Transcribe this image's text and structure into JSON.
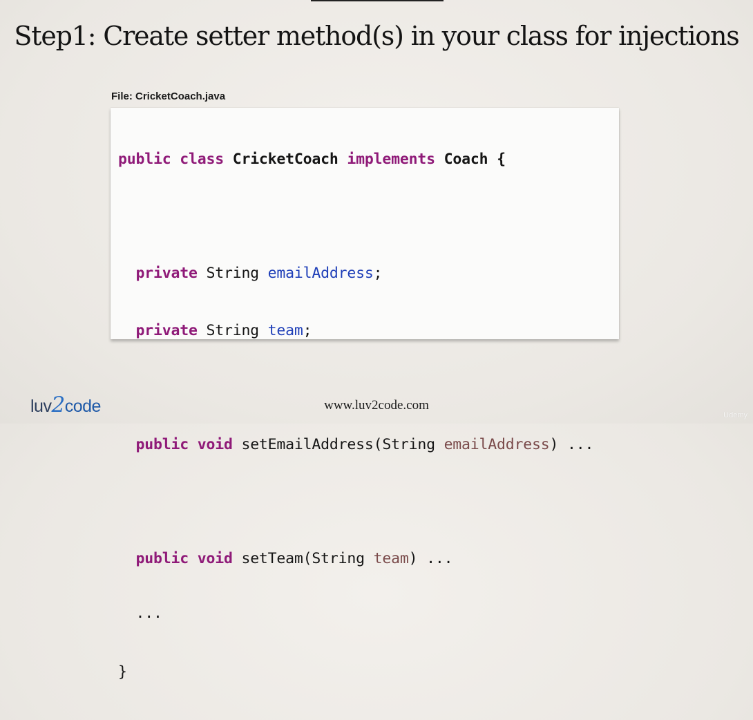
{
  "slide": {
    "title": "Step1: Create setter method(s) in your class for injections",
    "file_label": "File: CricketCoach.java"
  },
  "code": {
    "line1": {
      "kw1": "public",
      "kw2": "class",
      "cls1": "CricketCoach",
      "kw3": "implements",
      "cls2": "Coach",
      "brace": " {"
    },
    "line2": {
      "kw": "private",
      "type": " String ",
      "field": "emailAddress",
      "end": ";"
    },
    "line3": {
      "kw": "private",
      "type": " String ",
      "field": "team",
      "end": ";"
    },
    "line4": {
      "kw1": "public",
      "kw2": "void",
      "method": " setEmailAddress(String ",
      "param": "emailAddress",
      "end": ") ..."
    },
    "line5": {
      "kw1": "public",
      "kw2": "void",
      "method": " setTeam(String ",
      "param": "team",
      "end": ") ..."
    },
    "line6": {
      "text": "  ..."
    },
    "line7": {
      "text": "}"
    }
  },
  "footer": {
    "logo_part1": "luv",
    "logo_part2": "2",
    "logo_part3": "code",
    "url": "www.luv2code.com",
    "watermark": "Udemy"
  }
}
